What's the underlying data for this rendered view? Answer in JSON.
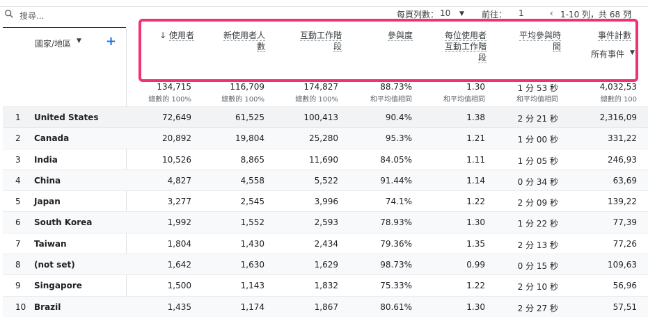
{
  "search": {
    "placeholder": "搜尋..."
  },
  "pagination": {
    "rows_per_page_label": "每頁列數：",
    "rows_per_page_value": "10",
    "goto_label": "前往：",
    "goto_value": "1",
    "range_text": "1-10 列，共 68 列"
  },
  "dimension": {
    "label": "國家/地區"
  },
  "metrics": [
    {
      "key": "users",
      "label": "使用者",
      "sort": "↓"
    },
    {
      "key": "new_users",
      "label": "新使用者人數"
    },
    {
      "key": "engaged_sessions",
      "label": "互動工作階段"
    },
    {
      "key": "engagement_rate",
      "label": "參與度"
    },
    {
      "key": "engaged_sessions_per_user",
      "label": "每位使用者互動工作階段"
    },
    {
      "key": "avg_engagement_time",
      "label": "平均參與時間"
    },
    {
      "key": "event_count",
      "label": "事件計數",
      "sub": "所有事件"
    }
  ],
  "totals": [
    {
      "value": "134,715",
      "sub": "總數的 100%"
    },
    {
      "value": "116,709",
      "sub": "總數的 100%"
    },
    {
      "value": "174,827",
      "sub": "總數的 100%"
    },
    {
      "value": "88.73%",
      "sub": "和平均值相同"
    },
    {
      "value": "1.30",
      "sub": "和平均值相同"
    },
    {
      "value": "1 分 53 秒",
      "sub": "和平均值相同"
    },
    {
      "value": "4,032,53",
      "sub": "總數的 100"
    }
  ],
  "rows": [
    {
      "rank": "1",
      "country": "United States",
      "values": [
        "72,649",
        "61,525",
        "100,413",
        "90.4%",
        "1.38",
        "2 分 21 秒",
        "2,316,09"
      ]
    },
    {
      "rank": "2",
      "country": "Canada",
      "values": [
        "20,892",
        "19,804",
        "25,280",
        "95.3%",
        "1.21",
        "1 分 00 秒",
        "331,22"
      ]
    },
    {
      "rank": "3",
      "country": "India",
      "values": [
        "10,526",
        "8,865",
        "11,690",
        "84.05%",
        "1.11",
        "1 分 05 秒",
        "246,93"
      ]
    },
    {
      "rank": "4",
      "country": "China",
      "values": [
        "4,827",
        "4,558",
        "5,522",
        "91.44%",
        "1.14",
        "0 分 34 秒",
        "63,69"
      ]
    },
    {
      "rank": "5",
      "country": "Japan",
      "values": [
        "3,277",
        "2,545",
        "3,996",
        "74.1%",
        "1.22",
        "2 分 09 秒",
        "139,22"
      ]
    },
    {
      "rank": "6",
      "country": "South Korea",
      "values": [
        "1,992",
        "1,552",
        "2,593",
        "78.93%",
        "1.30",
        "1 分 22 秒",
        "77,39"
      ]
    },
    {
      "rank": "7",
      "country": "Taiwan",
      "values": [
        "1,804",
        "1,430",
        "2,434",
        "79.36%",
        "1.35",
        "2 分 13 秒",
        "77,26"
      ]
    },
    {
      "rank": "8",
      "country": "(not set)",
      "values": [
        "1,642",
        "1,630",
        "1,629",
        "98.73%",
        "0.99",
        "0 分 15 秒",
        "109,63"
      ]
    },
    {
      "rank": "9",
      "country": "Singapore",
      "values": [
        "1,500",
        "1,143",
        "1,832",
        "75.33%",
        "1.22",
        "2 分 10 秒",
        "56,96"
      ]
    },
    {
      "rank": "10",
      "country": "Brazil",
      "values": [
        "1,435",
        "1,174",
        "1,867",
        "80.61%",
        "1.30",
        "2 分 27 秒",
        "57,51"
      ]
    }
  ],
  "colors": {
    "highlight_border": "#f2326e",
    "accent": "#1a73e8"
  }
}
